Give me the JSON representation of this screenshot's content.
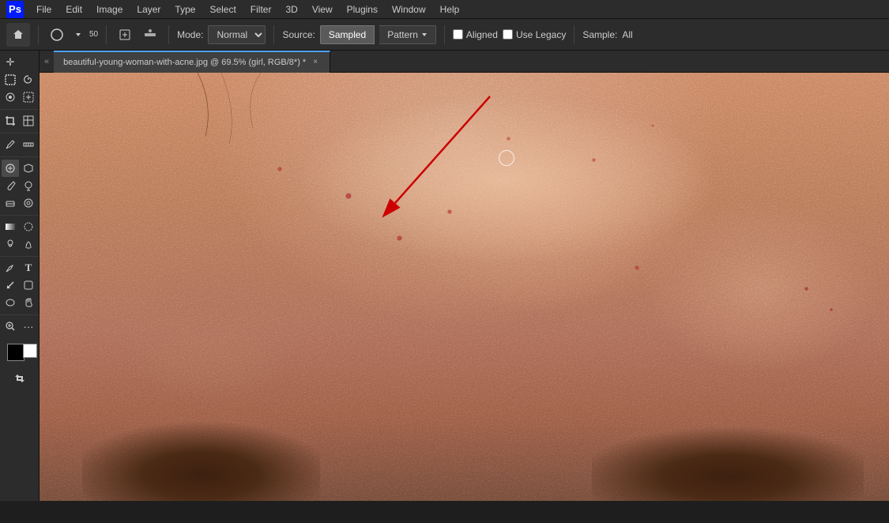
{
  "menubar": {
    "logo": "Ps",
    "items": [
      "File",
      "Edit",
      "Image",
      "Layer",
      "Type",
      "Select",
      "Filter",
      "3D",
      "View",
      "Plugins",
      "Window",
      "Help"
    ]
  },
  "optionsbar": {
    "mode_label": "Mode:",
    "mode_value": "Normal",
    "source_label": "Source:",
    "source_sampled": "Sampled",
    "source_pattern": "Pattern",
    "aligned_label": "Aligned",
    "use_legacy_label": "Use Legacy",
    "sample_label": "Sample:",
    "sample_value": "All",
    "brush_size": "50"
  },
  "tabbar": {
    "collapse_left": "«",
    "tab_title": "beautiful-young-woman-with-acne.jpg @ 69.5% (girl, RGB/8*) *",
    "tab_close": "×"
  },
  "toolbar": {
    "tools": [
      {
        "name": "move",
        "icon": "✛"
      },
      {
        "name": "marquee-rect",
        "icon": "⬚"
      },
      {
        "name": "lasso",
        "icon": "⌒"
      },
      {
        "name": "brush-select",
        "icon": "⊙"
      },
      {
        "name": "crop",
        "icon": "⌐"
      },
      {
        "name": "patch",
        "icon": "⊠"
      },
      {
        "name": "eyedropper",
        "icon": "✏"
      },
      {
        "name": "spot-heal",
        "icon": "🔧"
      },
      {
        "name": "brush",
        "icon": "✒"
      },
      {
        "name": "stamp",
        "icon": "⊕"
      },
      {
        "name": "eraser",
        "icon": "◻"
      },
      {
        "name": "heal-brush",
        "icon": "◎"
      },
      {
        "name": "gradient",
        "icon": "▣"
      },
      {
        "name": "blur",
        "icon": "◉"
      },
      {
        "name": "dodge",
        "icon": "◌"
      },
      {
        "name": "pen",
        "icon": "✒"
      },
      {
        "name": "text",
        "icon": "T"
      },
      {
        "name": "path-select",
        "icon": "↖"
      },
      {
        "name": "ellipse",
        "icon": "○"
      },
      {
        "name": "hand",
        "icon": "✋"
      },
      {
        "name": "zoom",
        "icon": "🔍"
      },
      {
        "name": "more",
        "icon": "···"
      }
    ]
  }
}
